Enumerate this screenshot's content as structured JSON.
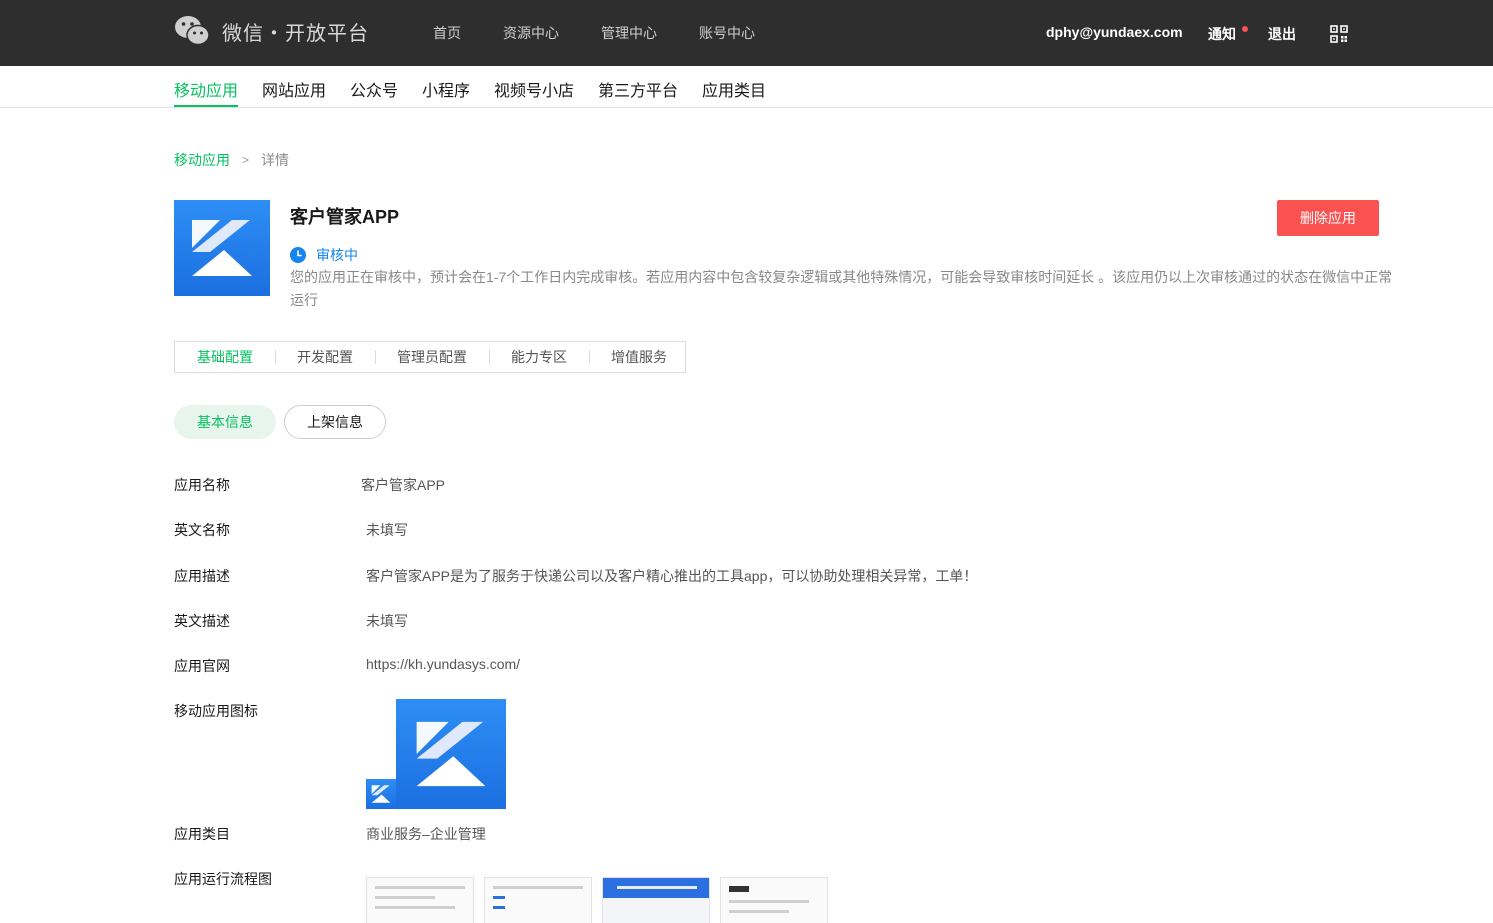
{
  "brand": {
    "title": "微信・开放平台"
  },
  "topnav": [
    "首页",
    "资源中心",
    "管理中心",
    "账号中心"
  ],
  "user": {
    "email": "dphy@yundaex.com",
    "notify_label": "通知",
    "logout_label": "退出"
  },
  "subnav": [
    "移动应用",
    "网站应用",
    "公众号",
    "小程序",
    "视频号小店",
    "第三方平台",
    "应用类目"
  ],
  "breadcrumb": {
    "parent": "移动应用",
    "separator": ">",
    "current": "详情"
  },
  "app": {
    "name": "客户管家APP",
    "status": "审核中",
    "status_desc": "您的应用正在审核中，预计会在1-7个工作日内完成审核。若应用内容中包含较复杂逻辑或其他特殊情况，可能会导致审核时间延长 。该应用仍以上次审核通过的状态在微信中正常运行",
    "delete_label": "删除应用"
  },
  "tabs": [
    "基础配置",
    "开发配置",
    "管理员配置",
    "能力专区",
    "增值服务"
  ],
  "pills": [
    "基本信息",
    "上架信息"
  ],
  "info": {
    "name": {
      "label": "应用名称",
      "value": "客户管家APP"
    },
    "en_name": {
      "label": "英文名称",
      "value": "未填写"
    },
    "desc": {
      "label": "应用描述",
      "value": "客户管家APP是为了服务于快递公司以及客户精心推出的工具app，可以协助处理相关异常，工单！"
    },
    "en_desc": {
      "label": "英文描述",
      "value": "未填写"
    },
    "website": {
      "label": "应用官网",
      "value": "https://kh.yundasys.com/"
    },
    "icon": {
      "label": "移动应用图标"
    },
    "category": {
      "label": "应用类目",
      "value": "商业服务–企业管理"
    },
    "flow": {
      "label": "应用运行流程图"
    }
  },
  "colors": {
    "accent": "#07c160",
    "danger": "#fa5151",
    "status_blue": "#1485ee",
    "topbar": "#2e2e2e"
  }
}
